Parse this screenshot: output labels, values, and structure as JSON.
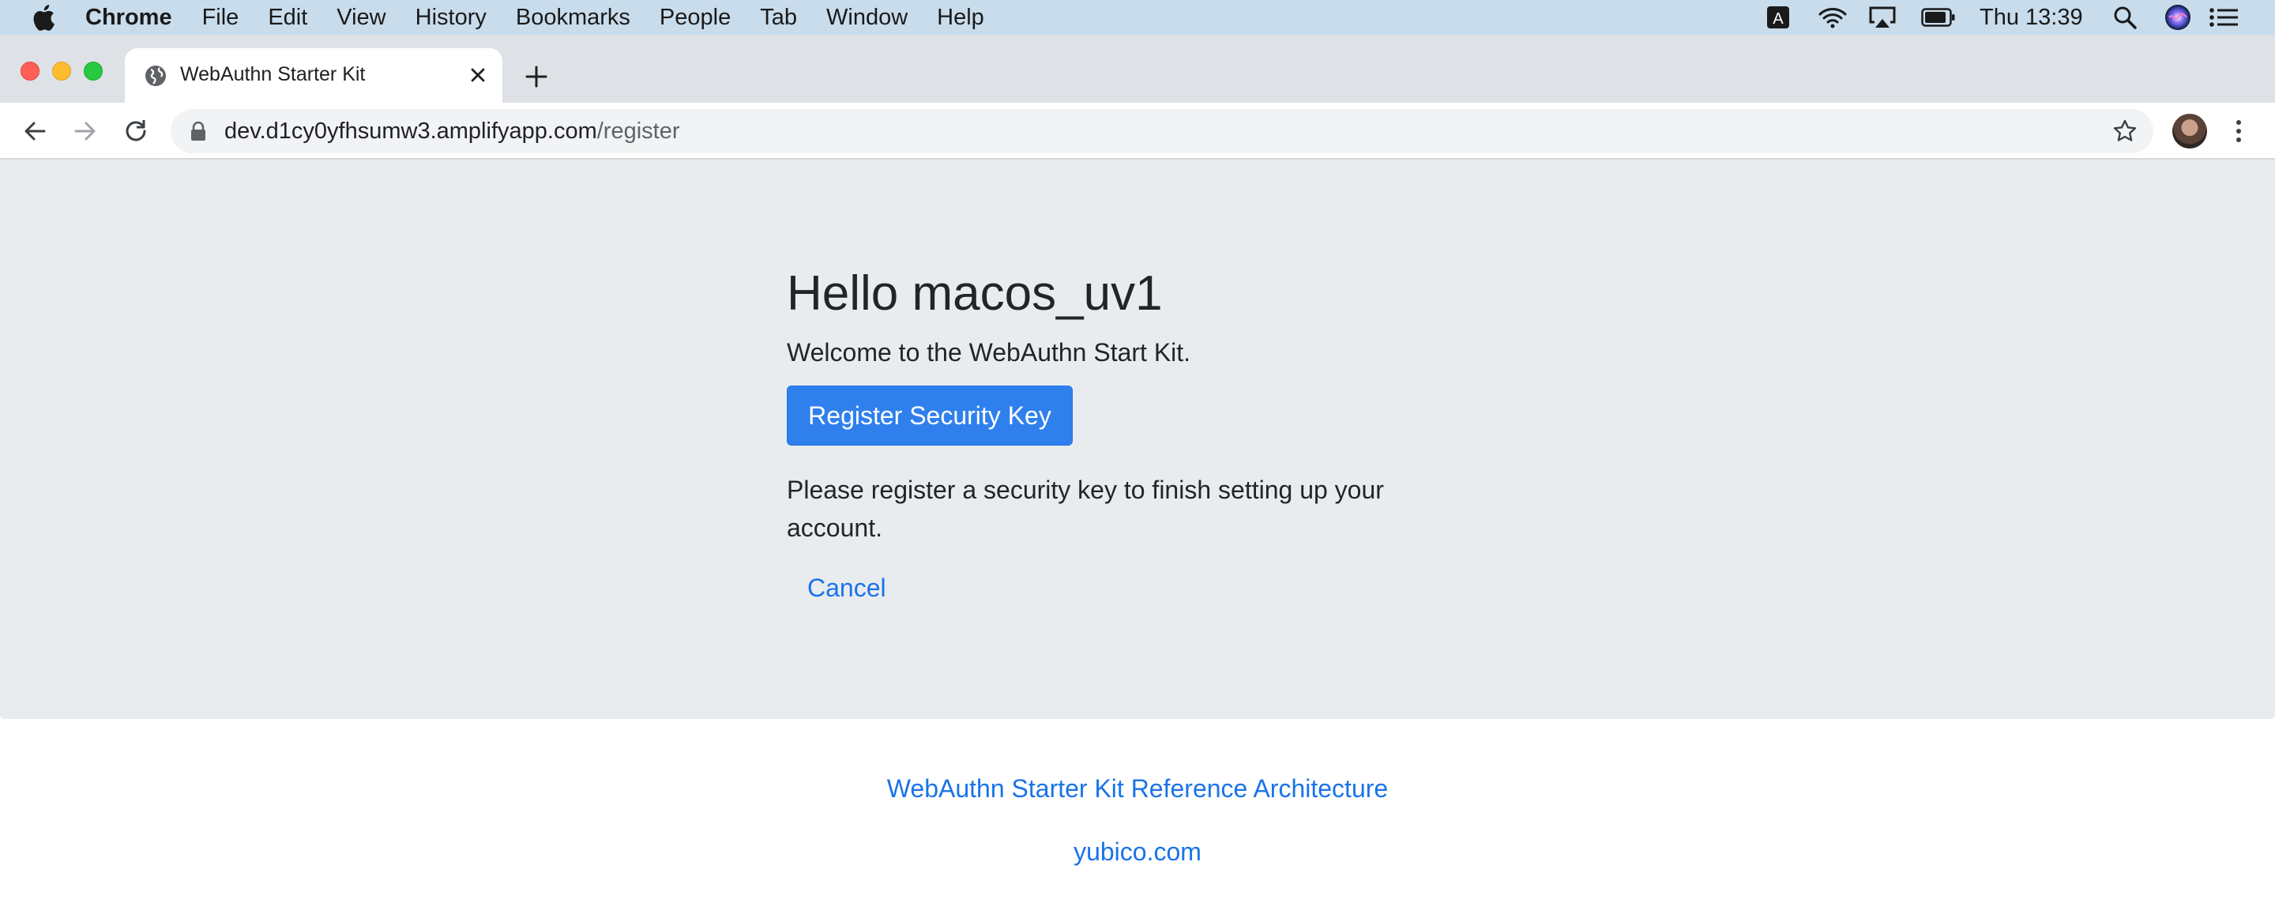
{
  "menubar": {
    "app_name": "Chrome",
    "items": [
      "File",
      "Edit",
      "View",
      "History",
      "Bookmarks",
      "People",
      "Tab",
      "Window",
      "Help"
    ],
    "status_icons": [
      "input-source-icon",
      "wifi-icon",
      "airplay-icon",
      "battery-icon",
      "spotlight-icon",
      "siri-icon",
      "control-center-icon"
    ],
    "input_source_letter": "A",
    "clock": "Thu 13:39"
  },
  "browser": {
    "tab": {
      "title": "WebAuthn Starter Kit",
      "favicon": "globe-icon"
    },
    "address": {
      "host": "dev.d1cy0yfhsumw3.amplifyapp.com",
      "path": "/register"
    }
  },
  "page": {
    "greeting": "Hello macos_uv1",
    "welcome": "Welcome to the WebAuthn Start Kit.",
    "register_button": "Register Security Key",
    "info": "Please register a security key to finish setting up your account.",
    "cancel": "Cancel"
  },
  "footer": {
    "architecture_link": "WebAuthn Starter Kit Reference Architecture",
    "yubico_link": "yubico.com"
  },
  "colors": {
    "menubar_bg": "#c8dcec",
    "tabstrip_bg": "#dee1e6",
    "jumbotron_bg": "#e9ecef",
    "primary_button": "#2f80ed",
    "link": "#1a73e8"
  }
}
